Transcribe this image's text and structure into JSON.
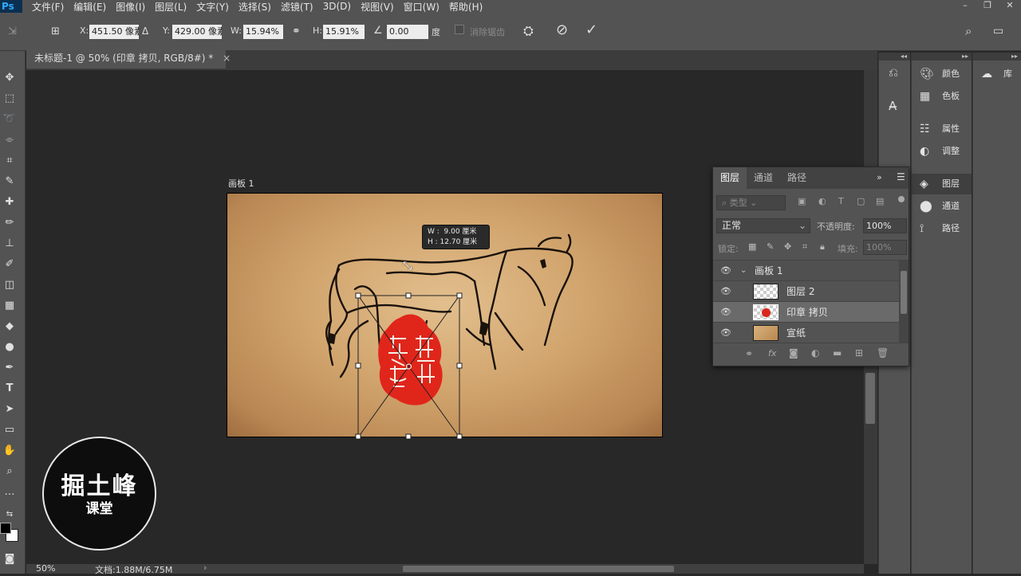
{
  "app": {
    "logo": "Ps",
    "accent": "#31a8ff"
  },
  "menu": [
    "文件(F)",
    "编辑(E)",
    "图像(I)",
    "图层(L)",
    "文字(Y)",
    "选择(S)",
    "滤镜(T)",
    "3D(D)",
    "视图(V)",
    "窗口(W)",
    "帮助(H)"
  ],
  "window_controls": {
    "minimize": "–",
    "restore": "❐",
    "close": "✕"
  },
  "options_bar": {
    "x_label": "X:",
    "x_value": "451.50 像素",
    "y_label": "Y:",
    "y_value": "429.00 像素",
    "w_label": "W:",
    "w_value": "15.94%",
    "h_label": "H:",
    "h_value": "15.91%",
    "angle_value": "0.00",
    "angle_unit": "度",
    "antialias_label": "消除锯齿"
  },
  "document_tab": {
    "title": "未标题-1 @ 50% (印章 拷贝, RGB/8#) *",
    "close": "×"
  },
  "artboard": {
    "label": "画板 1"
  },
  "transform_tooltip": {
    "w_label": "W :",
    "w_value": "9.00 厘米",
    "h_label": "H :",
    "h_value": "12.70 厘米"
  },
  "seal": {
    "color": "#e0261b"
  },
  "status_bar": {
    "zoom": "50%",
    "doc_info": "文档:1.88M/6.75M"
  },
  "watermark": {
    "line1": "掘土峰",
    "line2": "课堂"
  },
  "dock_col2": [
    {
      "icon": "palette-icon",
      "label": "颜色"
    },
    {
      "icon": "swatches-icon",
      "label": "色板"
    },
    {
      "icon": "properties-icon",
      "label": "属性"
    },
    {
      "icon": "adjustments-icon",
      "label": "调整"
    },
    {
      "icon": "layers-icon",
      "label": "图层"
    },
    {
      "icon": "channels-icon",
      "label": "通道"
    },
    {
      "icon": "paths-icon",
      "label": "路径"
    }
  ],
  "dock_col3": [
    {
      "icon": "cc-libraries-icon",
      "label": "库"
    }
  ],
  "layers_panel": {
    "tabs": [
      "图层",
      "通道",
      "路径"
    ],
    "filter_label": "类型",
    "blend_mode": "正常",
    "opacity_label": "不透明度:",
    "opacity_value": "100%",
    "lock_label": "锁定:",
    "fill_label": "填充:",
    "fill_value": "100%",
    "group_name": "画板 1",
    "layers": [
      {
        "name": "图层 2",
        "thumb": "transparent"
      },
      {
        "name": "印章 拷贝",
        "thumb": "seal",
        "selected": true
      },
      {
        "name": "宣纸",
        "thumb": "paper"
      }
    ],
    "footer_icons": [
      "link-icon",
      "fx-icon",
      "mask-icon",
      "adjustment-layer-icon",
      "group-icon",
      "new-layer-icon",
      "trash-icon"
    ]
  }
}
